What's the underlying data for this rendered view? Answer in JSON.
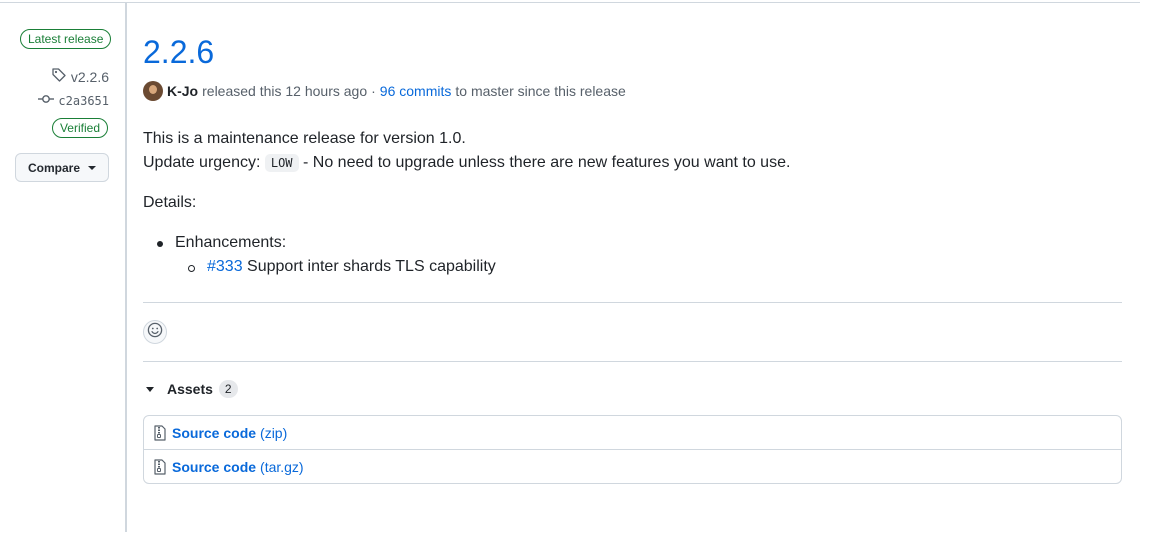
{
  "sidebar": {
    "latest_badge": "Latest release",
    "tag": "v2.2.6",
    "commit": "c2a3651",
    "verified": "Verified",
    "compare": "Compare"
  },
  "release": {
    "title": "2.2.6",
    "author": "K-Jo",
    "released_text": "released this 12 hours ago",
    "separator": "·",
    "commits_link": "96 commits",
    "commits_suffix": "to master since this release"
  },
  "body": {
    "line1": "This is a maintenance release for version 1.0.",
    "urgency_prefix": "Update urgency:",
    "urgency_code": "LOW",
    "urgency_suffix": "- No need to upgrade unless there are new features you want to use.",
    "details": "Details:",
    "list": [
      {
        "label": "Enhancements:",
        "items": [
          {
            "link": "#333",
            "text": "Support inter shards TLS capability"
          }
        ]
      }
    ]
  },
  "assets": {
    "label": "Assets",
    "count": "2",
    "files": [
      {
        "name": "Source code",
        "ext": "(zip)"
      },
      {
        "name": "Source code",
        "ext": "(tar.gz)"
      }
    ]
  },
  "colors": {
    "accent": "#0969da",
    "success": "#1a7f37",
    "border": "#d0d7de"
  },
  "icons": {
    "tag": "tag-icon",
    "commit": "git-commit-icon",
    "emoji": "smiley-icon",
    "file": "file-zip-icon",
    "caret": "triangle-down-icon"
  }
}
